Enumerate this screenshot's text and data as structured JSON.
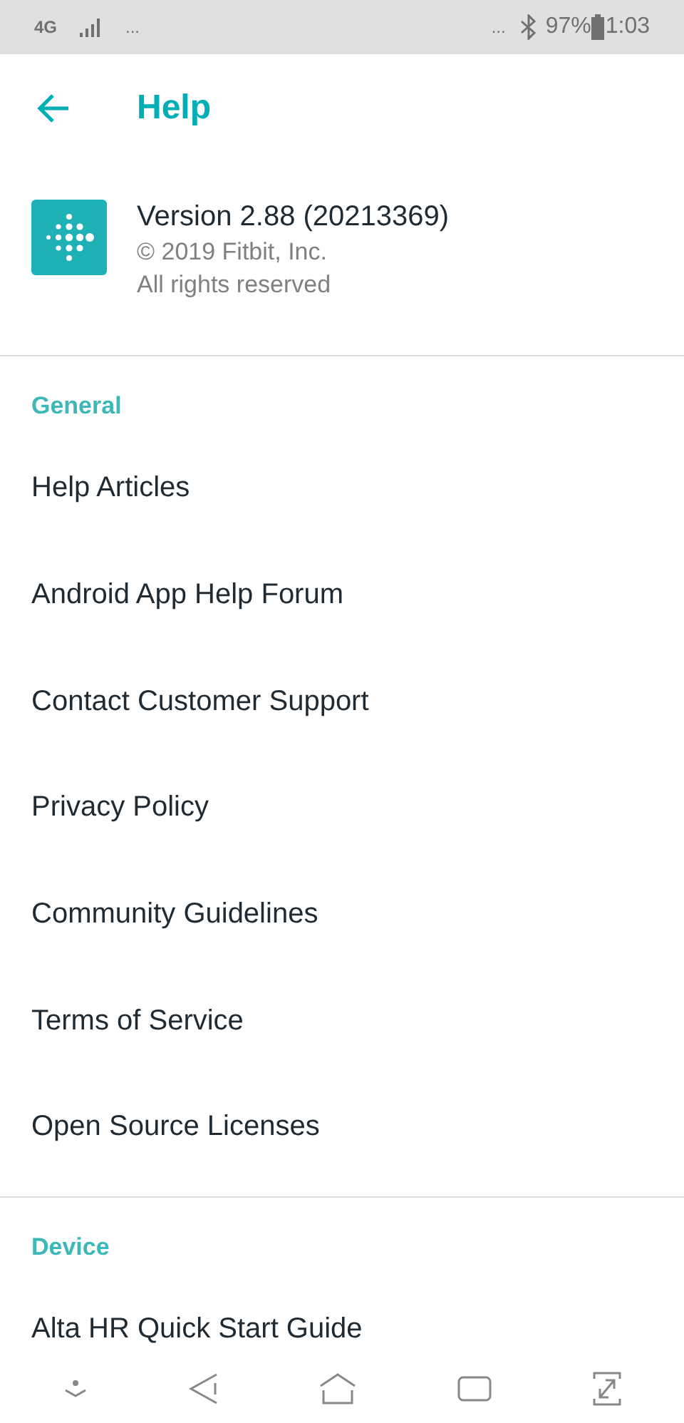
{
  "status_bar": {
    "network": "4G",
    "left_more": "...",
    "right_more": "...",
    "battery": "97%",
    "time": "1:03"
  },
  "header": {
    "title": "Help"
  },
  "app_info": {
    "version": "Version 2.88 (20213369)",
    "copyright": "© 2019 Fitbit, Inc.",
    "rights": "All rights reserved"
  },
  "sections": [
    {
      "title": "General",
      "items": [
        "Help Articles",
        "Android App Help Forum",
        "Contact Customer Support",
        "Privacy Policy",
        "Community Guidelines",
        "Terms of Service",
        "Open Source Licenses"
      ]
    },
    {
      "title": "Device",
      "items": [
        "Alta HR Quick Start Guide"
      ]
    }
  ]
}
